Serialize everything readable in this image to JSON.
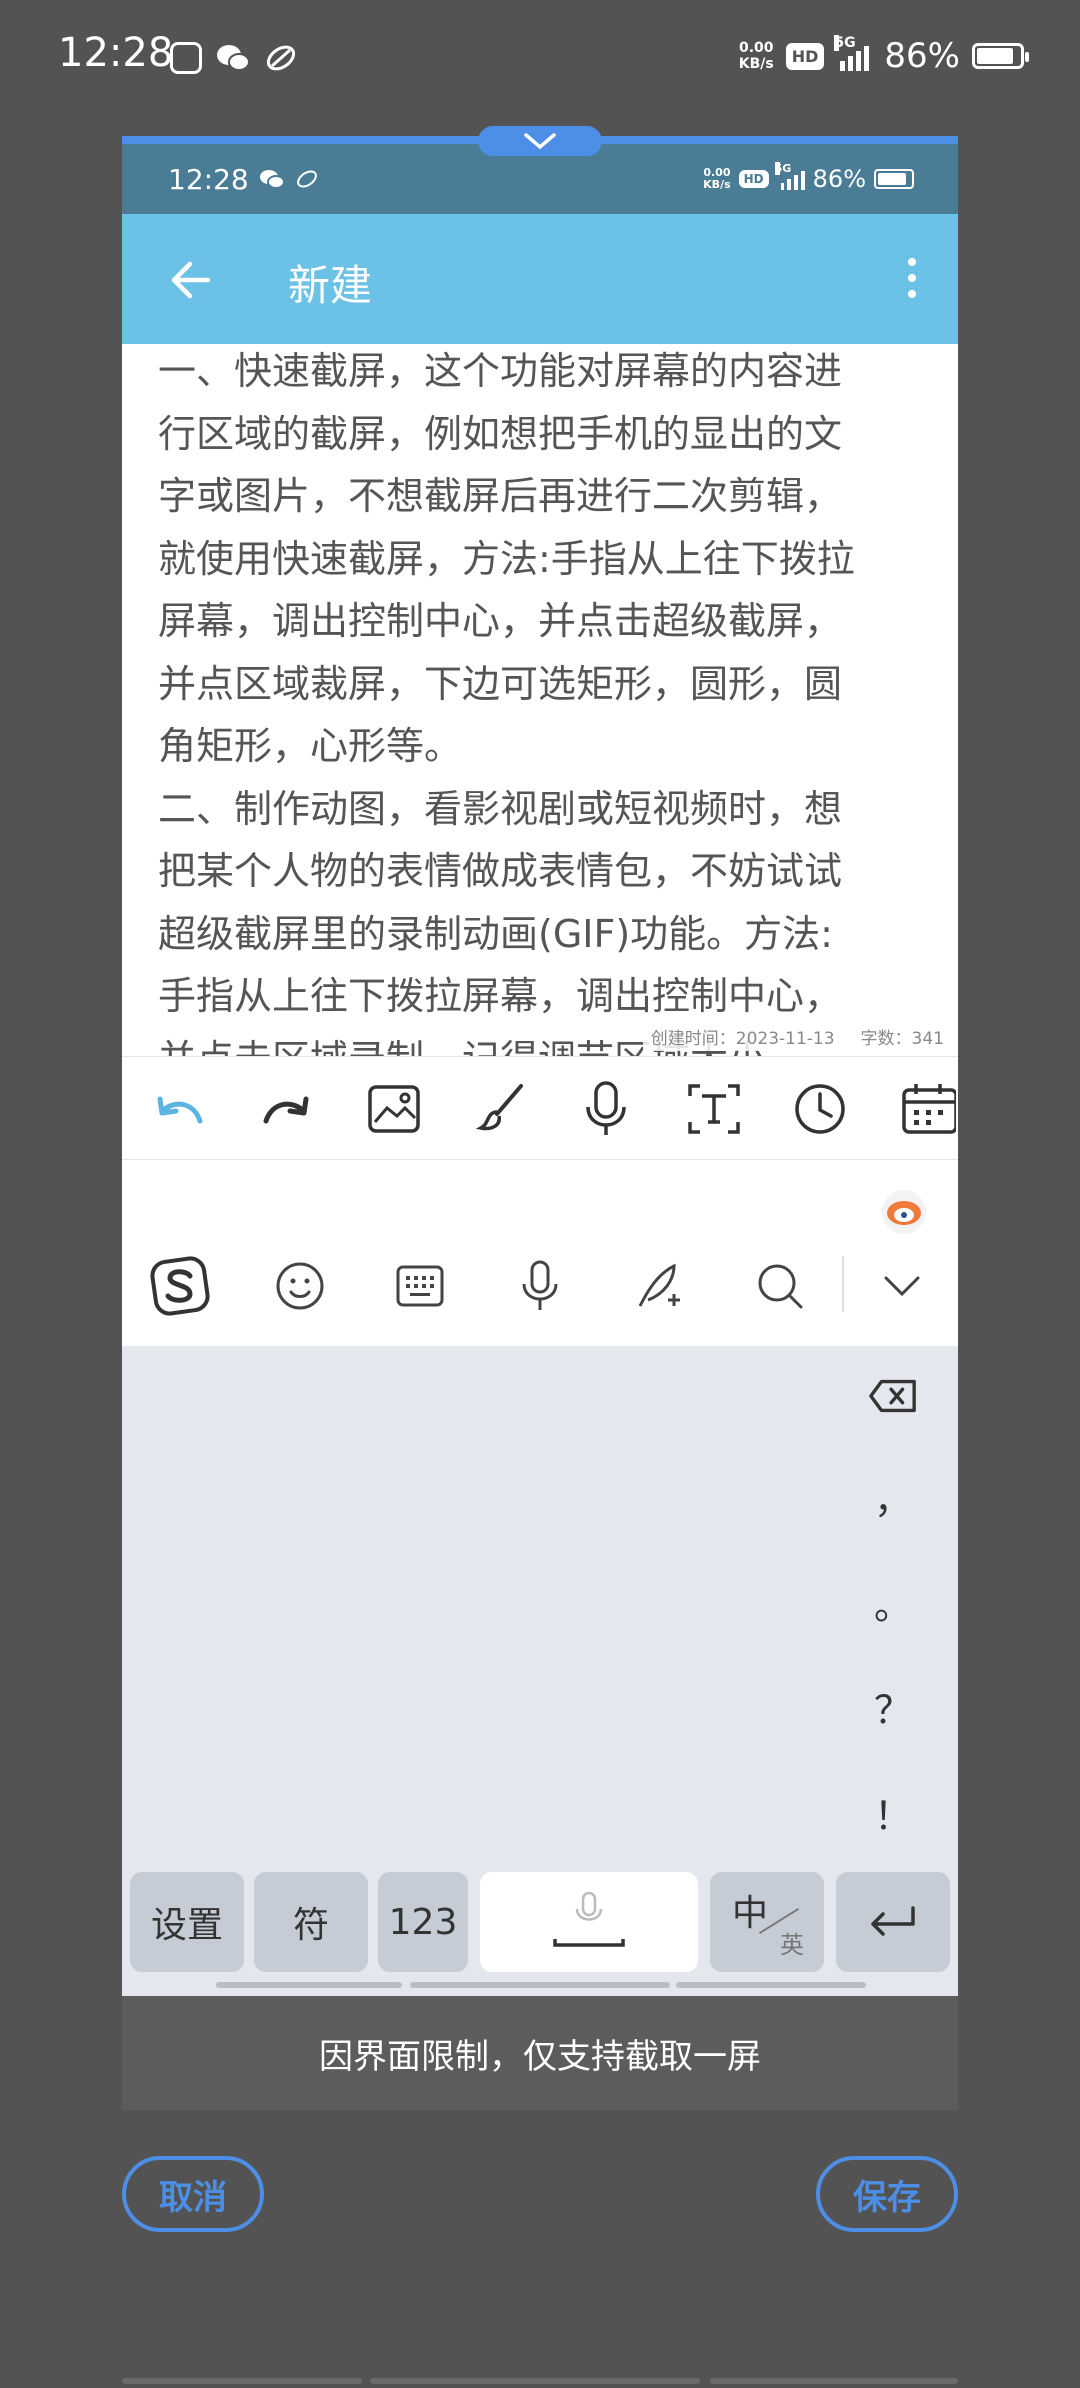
{
  "outer_status": {
    "time": "12:28",
    "net_speed_value": "0.00",
    "net_speed_unit": "KB/s",
    "hd": "HD",
    "network": "5G",
    "battery": "86%",
    "battery_level": 0.86
  },
  "inner_status": {
    "time": "12:28",
    "net_speed_value": "0.00",
    "net_speed_unit": "KB/s",
    "hd": "HD",
    "network": "5G",
    "battery": "86%",
    "battery_level": 0.86
  },
  "appbar": {
    "title": "新建"
  },
  "editor": {
    "content": "一、快速截屏，这个功能对屏幕的内容进\n行区域的截屏，例如想把手机的显出的文\n字或图片，不想截屏后再进行二次剪辑，\n就使用快速截屏，方法:手指从上往下拨拉\n屏幕，调出控制中心，并点击超级截屏，\n并点区域裁屏，下边可选矩形，圆形，圆\n角矩形，心形等。\n二、制作动图，看影视剧或短视频时，想\n把某个人物的表情做成表情包，不妨试试\n超级截屏里的录制动画(GIF)功能。方法:\n手指从上往下拨拉屏幕，调出控制中心，\n并点击区域录制，记得调节区域大小",
    "created_label": "创建时间：2023-11-13",
    "word_count": "字数：341"
  },
  "ime": {
    "punctuation": [
      "，",
      "。",
      "？",
      "！"
    ],
    "keys": {
      "settings": "设置",
      "symbols": "符",
      "numbers": "123",
      "zh": "中",
      "en": "英"
    }
  },
  "notice": "因界面限制，仅支持截取一屏",
  "actions": {
    "cancel": "取消",
    "save": "保存"
  }
}
